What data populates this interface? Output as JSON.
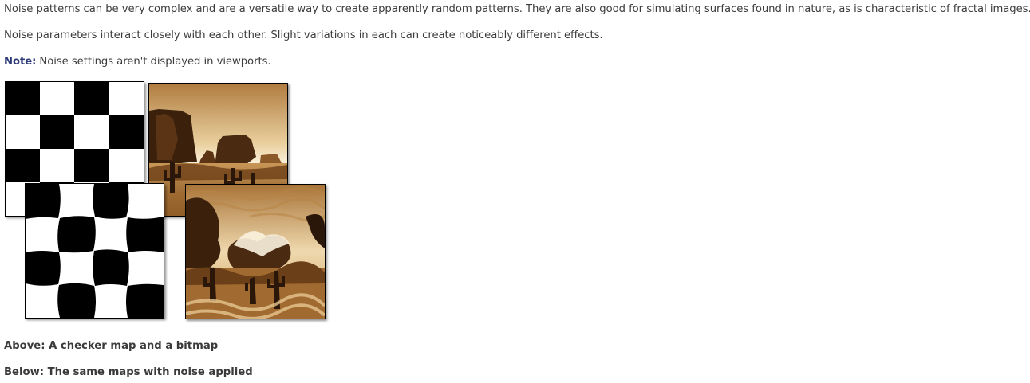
{
  "content": {
    "paragraph_1": "Noise patterns can be very complex and are a versatile way to create apparently random patterns. They are also good for simulating surfaces found in nature, as is characteristic of fractal images.",
    "paragraph_2": "Noise parameters interact closely with each other. Slight variations in each can create noticeably different effects.",
    "note_label": "Note:",
    "note_text": "Noise settings aren't displayed in viewports."
  },
  "figure": {
    "caption_above": "Above: A checker map and a bitmap",
    "caption_below": "Below: The same maps with noise applied",
    "colors": {
      "checker_dark": "#000000",
      "checker_light": "#ffffff",
      "sepia_light": "#f3e6cc",
      "sepia_mid": "#c99a5c",
      "sepia_dark": "#3b210c"
    }
  }
}
